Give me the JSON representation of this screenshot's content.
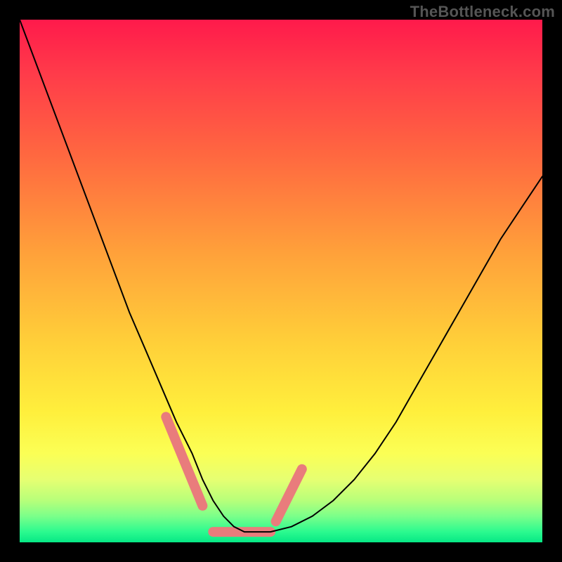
{
  "watermark": "TheBottleneck.com",
  "colors": {
    "background": "#000000",
    "marker": "#e97c7c",
    "curve": "#000000"
  },
  "chart_data": {
    "type": "line",
    "title": "",
    "xlabel": "",
    "ylabel": "",
    "xlim": [
      0,
      100
    ],
    "ylim": [
      0,
      100
    ],
    "grid": false,
    "legend": false,
    "series": [
      {
        "name": "bottleneck-curve",
        "x": [
          0,
          3,
          6,
          9,
          12,
          15,
          18,
          21,
          24,
          27,
          30,
          33,
          35,
          37,
          39,
          41,
          43,
          45,
          48,
          52,
          56,
          60,
          64,
          68,
          72,
          76,
          80,
          84,
          88,
          92,
          96,
          100
        ],
        "y": [
          100,
          92,
          84,
          76,
          68,
          60,
          52,
          44,
          37,
          30,
          23,
          17,
          12,
          8,
          5,
          3,
          2,
          2,
          2,
          3,
          5,
          8,
          12,
          17,
          23,
          30,
          37,
          44,
          51,
          58,
          64,
          70
        ]
      }
    ],
    "markers": {
      "name": "highlight-segments",
      "segments": [
        {
          "x": [
            28,
            35
          ],
          "y": [
            24,
            7
          ]
        },
        {
          "x": [
            37,
            48
          ],
          "y": [
            2,
            2
          ]
        },
        {
          "x": [
            49,
            54
          ],
          "y": [
            4,
            14
          ]
        }
      ]
    }
  }
}
